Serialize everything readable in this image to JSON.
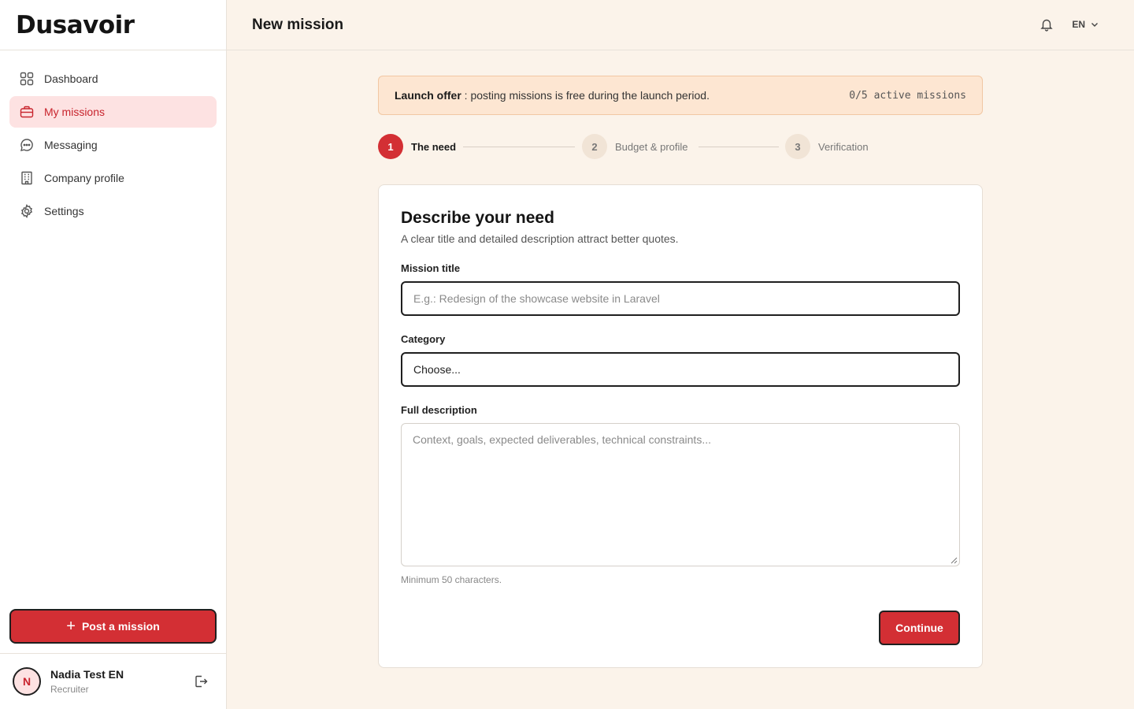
{
  "app": {
    "logo": "Dusavoir"
  },
  "sidebar": {
    "items": [
      {
        "label": "Dashboard",
        "icon": "dashboard-grid-icon"
      },
      {
        "label": "My missions",
        "icon": "briefcase-icon",
        "active": true
      },
      {
        "label": "Messaging",
        "icon": "chat-bubble-icon"
      },
      {
        "label": "Company profile",
        "icon": "building-icon"
      },
      {
        "label": "Settings",
        "icon": "gear-icon"
      }
    ],
    "post_button": {
      "icon": "plus-icon",
      "label": "Post a mission"
    },
    "user": {
      "initial": "N",
      "name": "Nadia Test EN",
      "role": "Recruiter"
    }
  },
  "header": {
    "title": "New mission",
    "language": "EN"
  },
  "banner": {
    "strong": "Launch offer",
    "text": " : posting missions is free during the launch period.",
    "count": "0/5 active missions"
  },
  "steps": [
    {
      "num": "1",
      "label": "The need",
      "state": "current"
    },
    {
      "num": "2",
      "label": "Budget & profile",
      "state": "pending"
    },
    {
      "num": "3",
      "label": "Verification",
      "state": "pending"
    }
  ],
  "form": {
    "title": "Describe your need",
    "subtitle": "A clear title and detailed description attract better quotes.",
    "mission_title": {
      "label": "Mission title",
      "placeholder": "E.g.: Redesign of the showcase website in Laravel"
    },
    "category": {
      "label": "Category",
      "value": "Choose..."
    },
    "description": {
      "label": "Full description",
      "placeholder": "Context, goals, expected deliverables, technical constraints...",
      "hint": "Minimum 50 characters."
    },
    "continue_label": "Continue"
  },
  "colors": {
    "accent": "#d32f34",
    "active_bg": "#fde2e2",
    "page_bg": "#fbf3ea",
    "banner_bg": "#fde6d2"
  }
}
